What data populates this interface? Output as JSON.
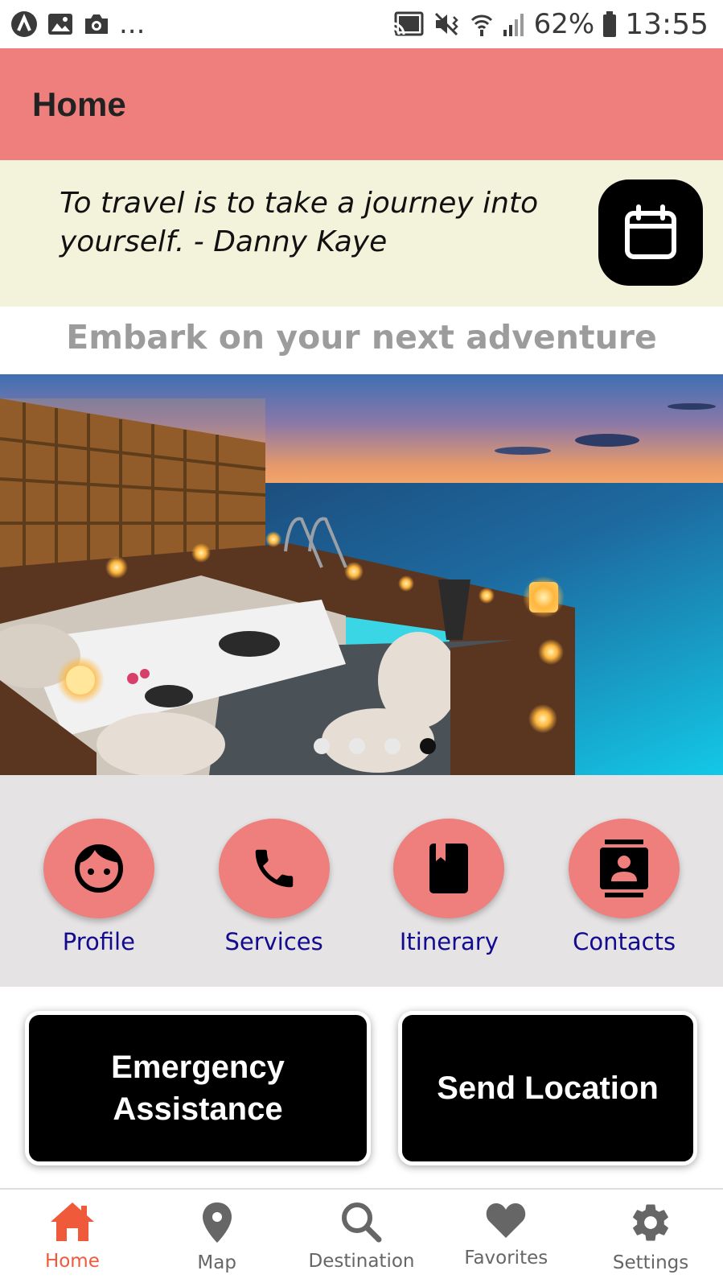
{
  "status_bar": {
    "more": "...",
    "battery": "62%",
    "time": "13:55",
    "icons": [
      "app-a-icon",
      "image-icon",
      "camera-icon",
      "cast-icon",
      "vibrate-mute-icon",
      "wifi-icon",
      "signal-icon",
      "battery-icon"
    ]
  },
  "header": {
    "title": "Home"
  },
  "quote": {
    "text": "To travel is to take a journey into yourself. - Danny Kaye",
    "button_icon": "calendar-icon"
  },
  "tagline": "Embark on your next adventure",
  "carousel": {
    "page_count": 4,
    "active_index": 3
  },
  "quick_actions": [
    {
      "label": "Profile",
      "icon": "face-icon"
    },
    {
      "label": "Services",
      "icon": "phone-icon"
    },
    {
      "label": "Itinerary",
      "icon": "book-icon"
    },
    {
      "label": "Contacts",
      "icon": "contacts-icon"
    }
  ],
  "buttons": {
    "emergency_line1": "Emergency",
    "emergency_line2": "Assistance",
    "send_location": "Send Location"
  },
  "bottom_nav": {
    "active": "Home",
    "items": [
      {
        "label": "Home",
        "icon": "home-icon"
      },
      {
        "label": "Map",
        "icon": "map-pin-icon"
      },
      {
        "label": "Destination",
        "icon": "search-icon"
      },
      {
        "label": "Favorites",
        "icon": "heart-icon"
      },
      {
        "label": "Settings",
        "icon": "gear-icon"
      }
    ]
  },
  "colors": {
    "primary": "#ef7f7c",
    "quote_bg": "#f3f3dc",
    "quick_bg": "#e5e3e3",
    "label_blue": "#120a8f",
    "nav_active": "#ef5a3a"
  }
}
